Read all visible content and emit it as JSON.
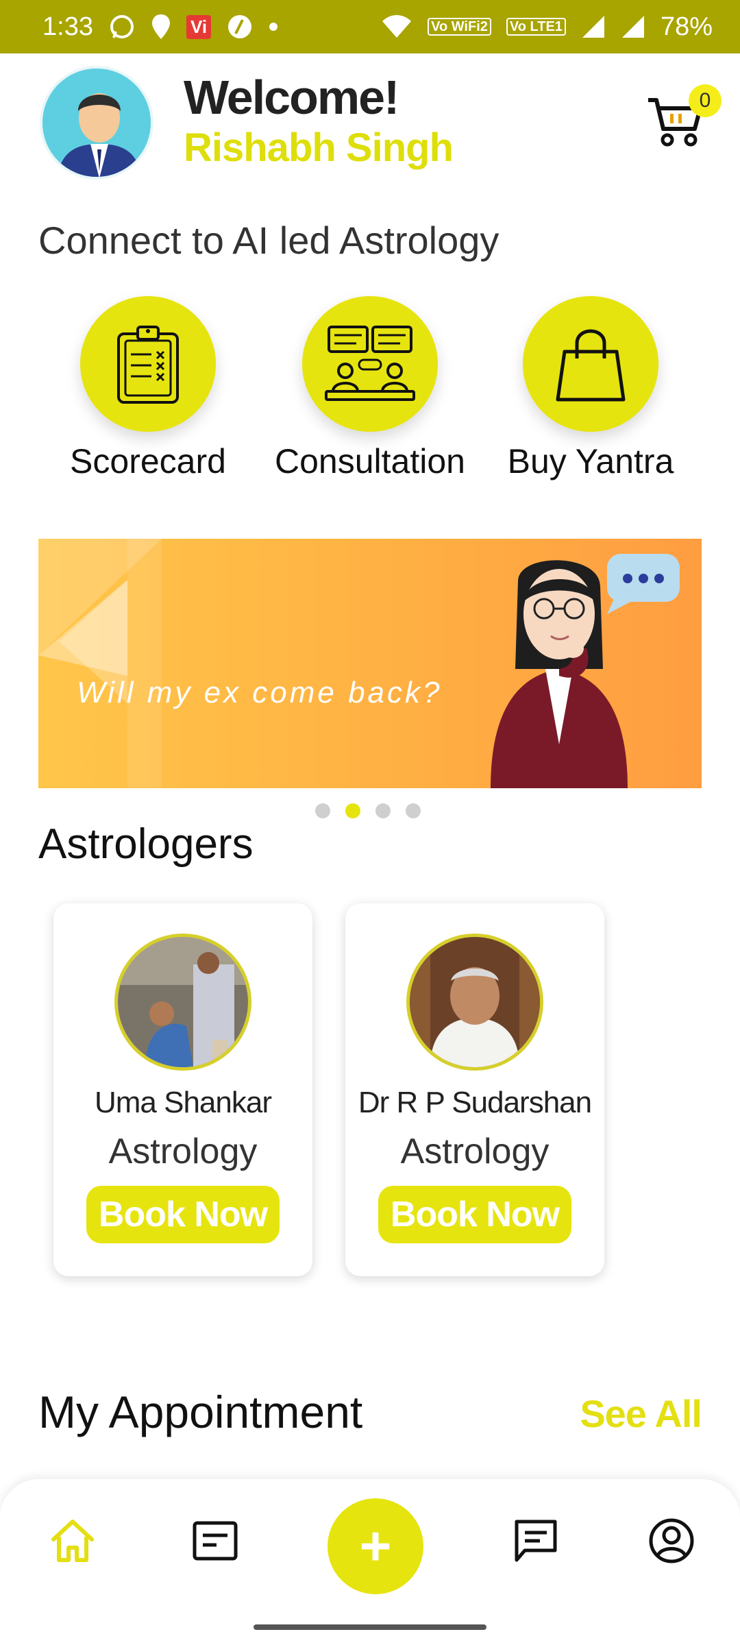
{
  "status_bar": {
    "time": "1:33",
    "carrier_badge": "Vi",
    "vowifi_label": "Vo WiFi2",
    "volte_label": "Vo LTE1",
    "battery": "78%"
  },
  "header": {
    "welcome": "Welcome!",
    "user_name": "Rishabh Singh",
    "cart_count": "0"
  },
  "services_section": {
    "title": "Connect to AI led Astrology",
    "items": [
      {
        "label": "Scorecard",
        "icon": "clipboard-icon"
      },
      {
        "label": "Consultation",
        "icon": "consultation-icon"
      },
      {
        "label": "Buy Yantra",
        "icon": "shopping-bag-icon"
      }
    ]
  },
  "banner": {
    "text": "Will my ex come back?",
    "active_slide": 2,
    "slide_count": 4
  },
  "astrologers": {
    "title": "Astrologers",
    "items": [
      {
        "name": "Uma Shankar",
        "skill": "Astrology",
        "button": "Book Now"
      },
      {
        "name": "Dr R P Sudarshan",
        "skill": "Astrology",
        "button": "Book Now"
      }
    ]
  },
  "appointments": {
    "title": "My Appointment",
    "see_all": "See All"
  },
  "bottom_nav": {
    "items": [
      "home-icon",
      "orders-icon",
      "add-icon",
      "chat-icon",
      "profile-icon"
    ],
    "fab_symbol": "+"
  },
  "colors": {
    "status_bar": "#a8a400",
    "accent": "#e6e40e",
    "accent_text": "#dede0b"
  }
}
